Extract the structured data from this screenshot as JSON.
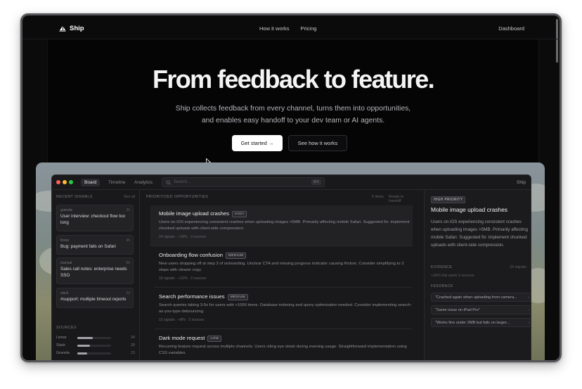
{
  "nav": {
    "brand": "Ship",
    "links": [
      "How it works",
      "Pricing"
    ],
    "dashboard": "Dashboard"
  },
  "hero": {
    "title": "From feedback to feature.",
    "subtitle_line1": "Ship collects feedback from every channel, turns them into opportunities,",
    "subtitle_line2": "and enables easy handoff to your dev team or AI agents.",
    "cta_primary": "Get started →",
    "cta_secondary": "See how it works"
  },
  "app": {
    "tabs": [
      "Board",
      "Timeline",
      "Analytics"
    ],
    "search_placeholder": "Search...",
    "search_kbd": "⌘K",
    "name": "Ship",
    "recent_signals": {
      "heading": "RECENT SIGNALS",
      "see_all": "See all",
      "items": [
        {
          "source": "granola",
          "age": "2h",
          "text": "User interview: checkout flow too long"
        },
        {
          "source": "linear",
          "age": "4h",
          "text": "Bug: payment fails on Safari"
        },
        {
          "source": "manual",
          "age": "6h",
          "text": "Sales call notes: enterprise needs SSO"
        },
        {
          "source": "slack",
          "age": "1d",
          "text": "#support: multiple timeout reports"
        }
      ]
    },
    "sources": {
      "heading": "SOURCES",
      "items": [
        {
          "name": "Linear",
          "count": "34",
          "level": 0.45
        },
        {
          "name": "Slack",
          "count": "28",
          "level": 0.38
        },
        {
          "name": "Granola",
          "count": "23",
          "level": 0.3
        }
      ]
    },
    "opportunities": {
      "heading": "PRIORITIZED OPPORTUNITIES",
      "count": "6 items",
      "handoff": "Ready to handoff",
      "items": [
        {
          "title": "Mobile image upload crashes",
          "priority": "HIGH",
          "desc": "Users on iOS experiencing consistent crashes when uploading images >5MB. Primarily affecting mobile Safari. Suggested fix: implement chunked uploads with client-side compression.",
          "meta": "24 signals · +18% · 3 sources"
        },
        {
          "title": "Onboarding flow confusion",
          "priority": "MEDIUM",
          "desc": "New users dropping off at step 3 of onboarding. Unclear CTA and missing progress indicator causing friction. Consider simplifying to 2 steps with clearer copy.",
          "meta": "18 signals · +12% · 2 sources"
        },
        {
          "title": "Search performance issues",
          "priority": "MEDIUM",
          "desc": "Search queries taking 3-5s for users with >1000 items. Database indexing and query optimization needed. Consider implementing search-as-you-type debouncing.",
          "meta": "15 signals · +8% · 2 sources"
        },
        {
          "title": "Dark mode request",
          "priority": "LOW",
          "desc": "Recurring feature request across multiple channels. Users citing eye strain during evening usage. Straightforward implementation using CSS variables.",
          "meta": ""
        }
      ]
    },
    "detail": {
      "priority": "HIGH PRIORITY",
      "title": "Mobile image upload crashes",
      "desc": "Users on iOS experiencing consistent crashes when uploading images >5MB. Primarily affecting mobile Safari. Suggested fix: implement chunked uploads with client-side compression.",
      "evidence_heading": "EVIDENCE",
      "evidence_count": "24 signals",
      "evidence_meta": "+18%   this week   3 sources",
      "feedback_heading": "FEEDBACK",
      "feedback": [
        "\"Crashed again when uploading from camera...",
        "\"Same issue on iPad Pro\"",
        "\"Works fine under 2MB but fails on larger..."
      ]
    }
  },
  "colors": {
    "background": "#0b0b0c",
    "accent_white": "#ffffff",
    "panel": "#19191b"
  }
}
